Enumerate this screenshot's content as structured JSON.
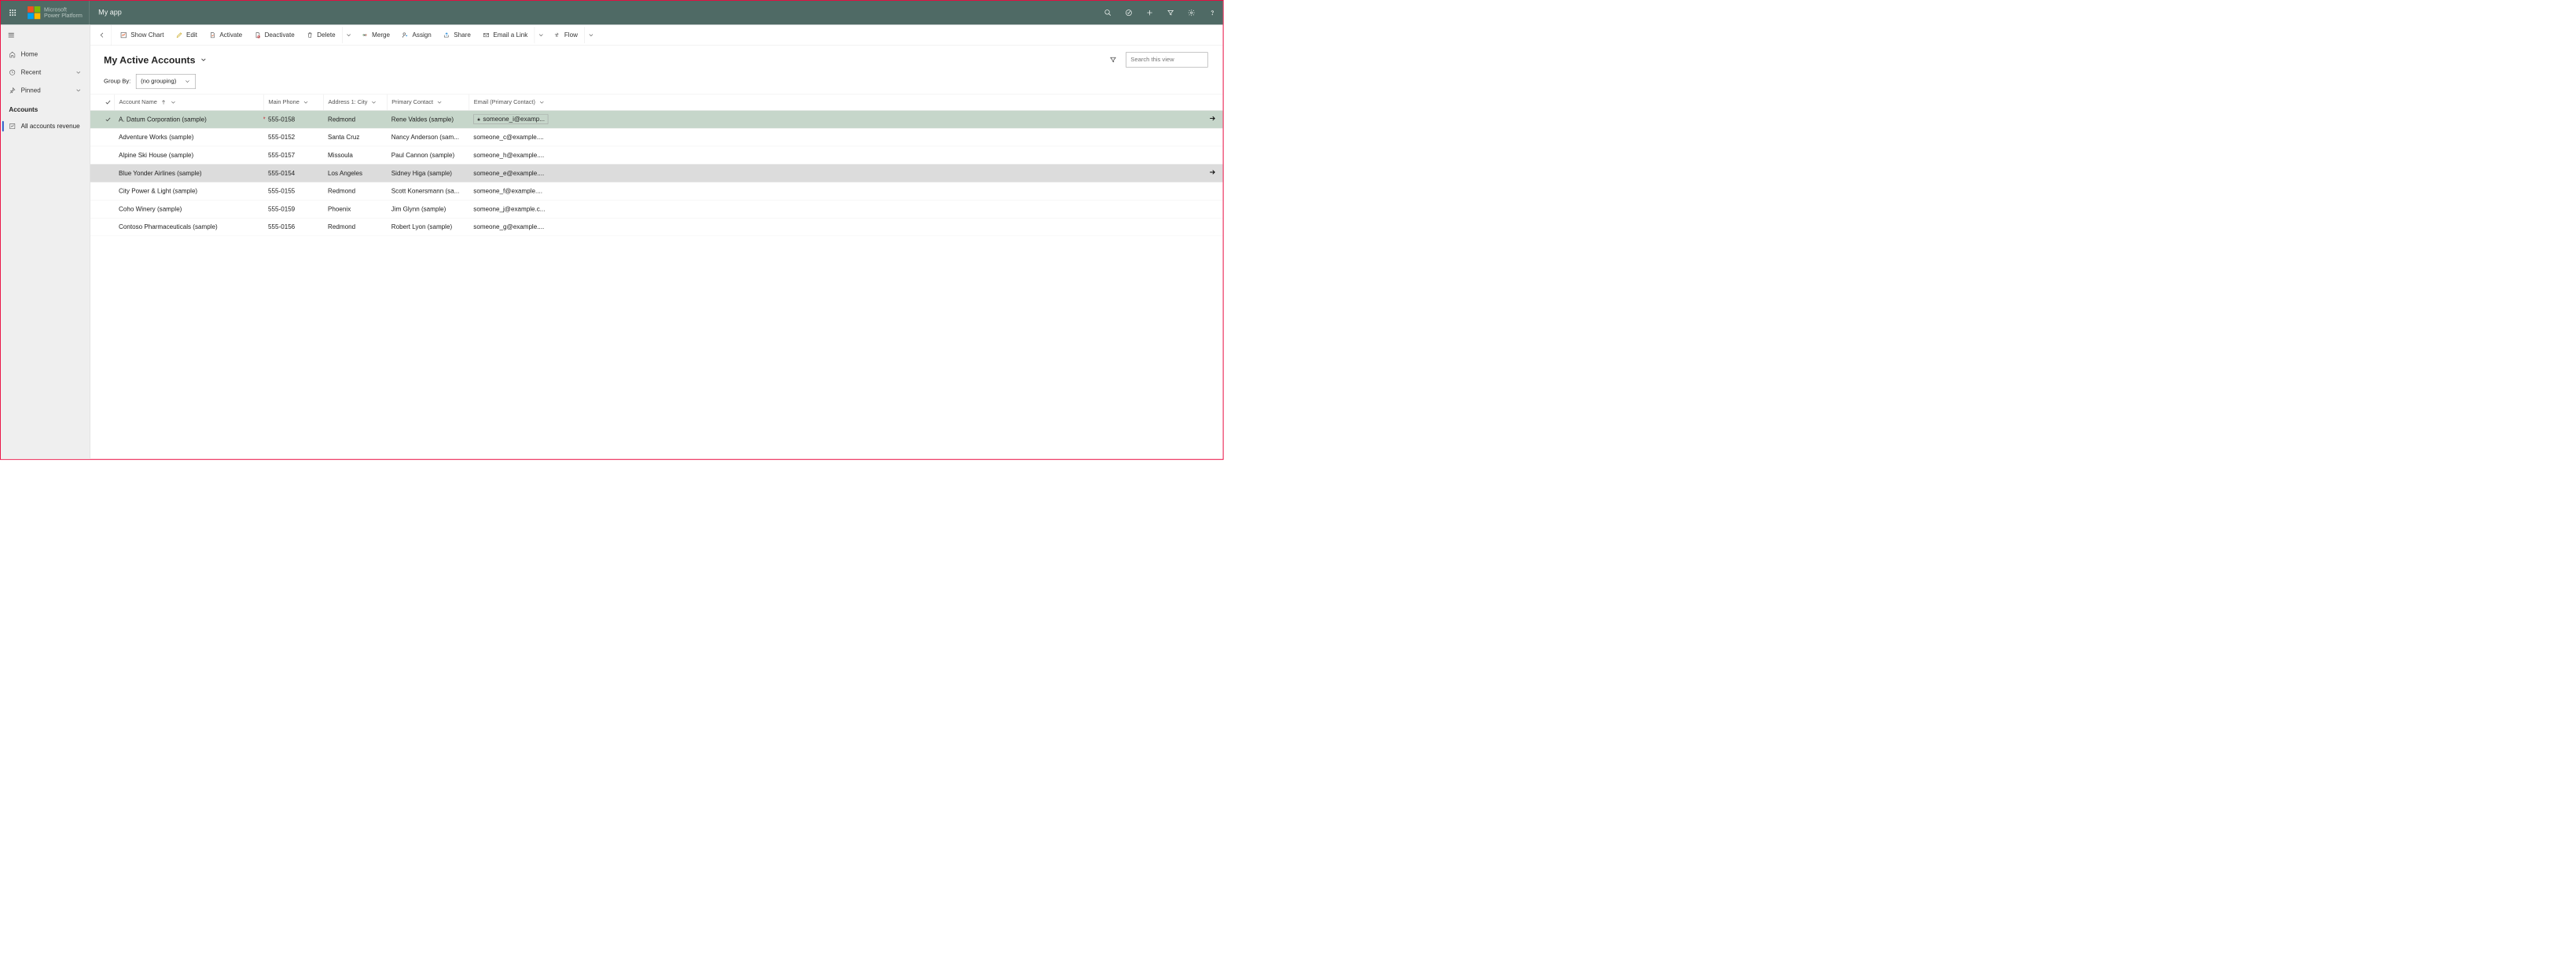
{
  "appbar": {
    "brand_line1": "Microsoft",
    "brand_line2": "Power Platform",
    "app_name": "My app"
  },
  "sidebar": {
    "items": {
      "home": "Home",
      "recent": "Recent",
      "pinned": "Pinned"
    },
    "group_title": "Accounts",
    "sub_item": "All accounts revenue"
  },
  "commands": {
    "show_chart": "Show Chart",
    "edit": "Edit",
    "activate": "Activate",
    "deactivate": "Deactivate",
    "delete": "Delete",
    "merge": "Merge",
    "assign": "Assign",
    "share": "Share",
    "email_link": "Email a Link",
    "flow": "Flow"
  },
  "view": {
    "title": "My Active Accounts",
    "search_placeholder": "Search this view",
    "group_by_label": "Group By:",
    "group_by_value": "(no grouping)"
  },
  "columns": {
    "name": "Account Name",
    "phone": "Main Phone",
    "city": "Address 1: City",
    "contact": "Primary Contact",
    "email": "Email (Primary Contact)"
  },
  "rows": [
    {
      "name": "A. Datum Corporation (sample)",
      "phone": "555-0158",
      "city": "Redmond",
      "contact": "Rene Valdes (sample)",
      "email": "someone_i@examp...",
      "selected": true,
      "required": true,
      "locked": true
    },
    {
      "name": "Adventure Works (sample)",
      "phone": "555-0152",
      "city": "Santa Cruz",
      "contact": "Nancy Anderson (sam...",
      "email": "someone_c@example....",
      "selected": false
    },
    {
      "name": "Alpine Ski House (sample)",
      "phone": "555-0157",
      "city": "Missoula",
      "contact": "Paul Cannon (sample)",
      "email": "someone_h@example....",
      "selected": false
    },
    {
      "name": "Blue Yonder Airlines (sample)",
      "phone": "555-0154",
      "city": "Los Angeles",
      "contact": "Sidney Higa (sample)",
      "email": "someone_e@example....",
      "selected": false,
      "hover": true
    },
    {
      "name": "City Power & Light (sample)",
      "phone": "555-0155",
      "city": "Redmond",
      "contact": "Scott Konersmann (sa...",
      "email": "someone_f@example....",
      "selected": false
    },
    {
      "name": "Coho Winery (sample)",
      "phone": "555-0159",
      "city": "Phoenix",
      "contact": "Jim Glynn (sample)",
      "email": "someone_j@example.c...",
      "selected": false
    },
    {
      "name": "Contoso Pharmaceuticals (sample)",
      "phone": "555-0156",
      "city": "Redmond",
      "contact": "Robert Lyon (sample)",
      "email": "someone_g@example....",
      "selected": false
    }
  ]
}
